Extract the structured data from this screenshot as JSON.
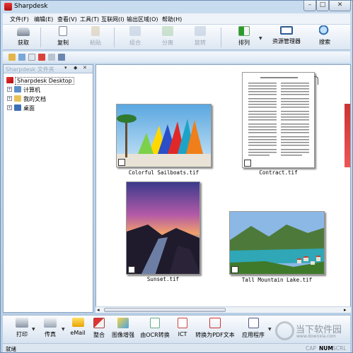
{
  "window": {
    "title": "Sharpdesk"
  },
  "menu": [
    "文件(F)",
    "编辑(E)",
    "查看(V)",
    "工具(T)",
    "互联网(I)",
    "输出区域(O)",
    "帮助(H)"
  ],
  "toolbar": {
    "items": [
      {
        "label": "获取",
        "icon": "scanner-icon",
        "enabled": true
      },
      {
        "label": "复制",
        "icon": "copy-icon",
        "enabled": true
      },
      {
        "label": "粘贴",
        "icon": "paste-icon",
        "enabled": false
      },
      {
        "label": "组合",
        "icon": "combine-icon",
        "enabled": false
      },
      {
        "label": "分离",
        "icon": "separate-icon",
        "enabled": false
      },
      {
        "label": "旋转",
        "icon": "rotate-icon",
        "enabled": false
      },
      {
        "label": "排列",
        "icon": "arrange-icon",
        "enabled": true
      },
      {
        "label": "资源管理器",
        "icon": "explorer-icon",
        "enabled": true
      },
      {
        "label": "搜索",
        "icon": "search-icon",
        "enabled": true
      }
    ]
  },
  "panel": {
    "title": "Sharpdesk 文件夹",
    "controls": [
      "▾",
      "◆",
      "✕"
    ]
  },
  "tree": [
    {
      "label": "Sharpdesk Desktop",
      "icon": "sharpdesk-icon",
      "expander": "",
      "selected": true
    },
    {
      "label": "计算机",
      "icon": "computer-icon",
      "expander": "+"
    },
    {
      "label": "我的文档",
      "icon": "documents-icon",
      "expander": "+"
    },
    {
      "label": "桌面",
      "icon": "desktop-icon",
      "expander": "+"
    }
  ],
  "files": [
    {
      "name": "Colorful Sailboats.tif"
    },
    {
      "name": "Contract.tif"
    },
    {
      "name": "Sunset.tif"
    },
    {
      "name": "Tall Mountain Lake.tif"
    }
  ],
  "bottombar": {
    "items": [
      {
        "label": "打印",
        "icon": "printer-icon"
      },
      {
        "label": "传真",
        "icon": "fax-icon"
      },
      {
        "label": "eMail",
        "icon": "email-icon"
      },
      {
        "label": "整合",
        "icon": "integrate-icon"
      },
      {
        "label": "图像增强",
        "icon": "image-enhance-icon"
      },
      {
        "label": "由OCR转换",
        "icon": "ocr-icon"
      },
      {
        "label": "ICT",
        "icon": "ict-icon"
      },
      {
        "label": "转换为PDF文本",
        "icon": "pdf-icon"
      },
      {
        "label": "应用程序",
        "icon": "application-icon"
      }
    ]
  },
  "status": {
    "left": "就绪",
    "indicators": [
      "CAP",
      "NUM",
      "SCRL"
    ]
  },
  "watermark": {
    "main": "当下软件园",
    "sub": "www.downxia.com"
  }
}
